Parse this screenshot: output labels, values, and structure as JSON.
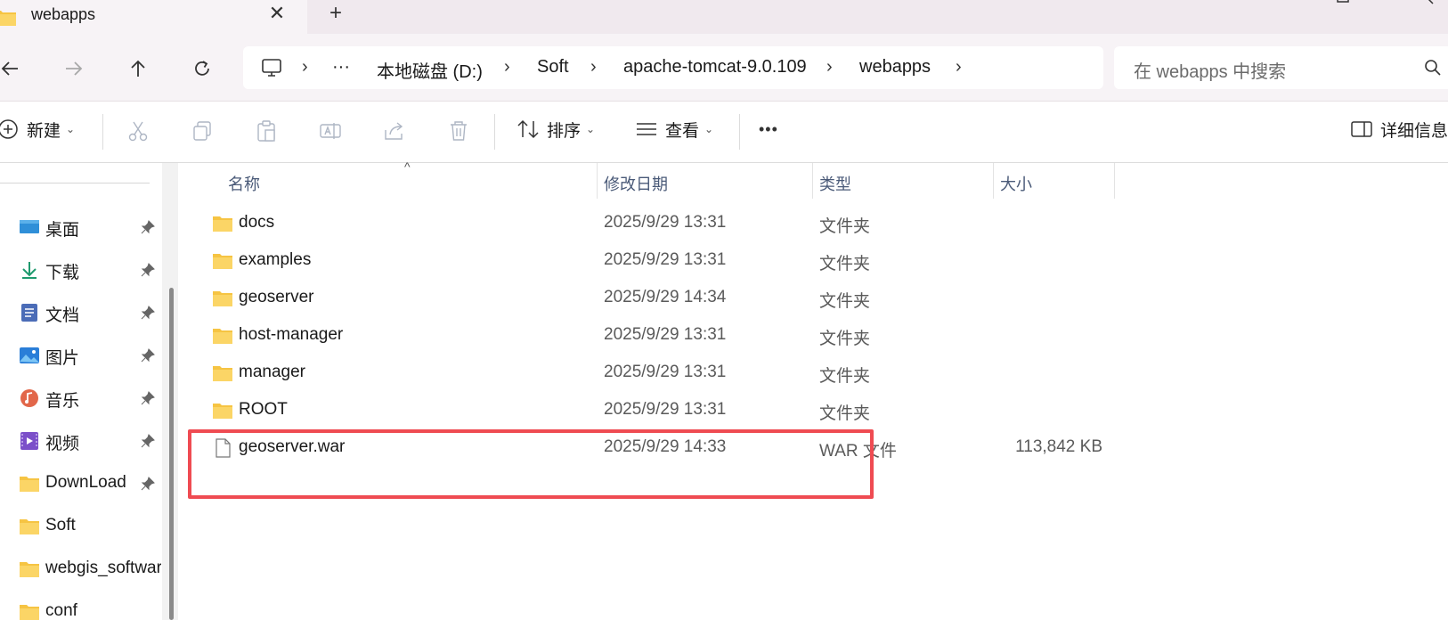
{
  "window": {
    "tab_title": "webapps",
    "close_glyph": "✕",
    "new_tab_glyph": "+"
  },
  "address": {
    "more": "···",
    "crumbs": [
      "本地磁盘 (D:)",
      "Soft",
      "apache-tomcat-9.0.109",
      "webapps"
    ],
    "sep": "›"
  },
  "search": {
    "placeholder": "在 webapps 中搜索"
  },
  "toolbar": {
    "new_label": "新建",
    "sort_label": "排序",
    "view_label": "查看",
    "more_label": "•••",
    "details_label": "详细信息",
    "chevron": "⌄"
  },
  "sidebar": {
    "items": [
      {
        "label": "桌面",
        "icon": "desktop-icon",
        "pinned": true
      },
      {
        "label": "下载",
        "icon": "download-icon",
        "pinned": true
      },
      {
        "label": "文档",
        "icon": "document-icon",
        "pinned": true
      },
      {
        "label": "图片",
        "icon": "pictures-icon",
        "pinned": true
      },
      {
        "label": "音乐",
        "icon": "music-icon",
        "pinned": true
      },
      {
        "label": "视频",
        "icon": "video-icon",
        "pinned": true
      },
      {
        "label": "DownLoad",
        "icon": "folder-icon",
        "pinned": true
      },
      {
        "label": "Soft",
        "icon": "folder-icon",
        "pinned": false
      },
      {
        "label": "webgis_software",
        "icon": "folder-icon",
        "pinned": false
      },
      {
        "label": "conf",
        "icon": "folder-icon",
        "pinned": false
      }
    ]
  },
  "columns": {
    "name": "名称",
    "date": "修改日期",
    "type": "类型",
    "size": "大小",
    "sort_glyph": "^"
  },
  "files": [
    {
      "name": "docs",
      "date": "2025/9/29 13:31",
      "type": "文件夹",
      "size": "",
      "icon": "folder-icon"
    },
    {
      "name": "examples",
      "date": "2025/9/29 13:31",
      "type": "文件夹",
      "size": "",
      "icon": "folder-icon"
    },
    {
      "name": "geoserver",
      "date": "2025/9/29 14:34",
      "type": "文件夹",
      "size": "",
      "icon": "folder-icon"
    },
    {
      "name": "host-manager",
      "date": "2025/9/29 13:31",
      "type": "文件夹",
      "size": "",
      "icon": "folder-icon"
    },
    {
      "name": "manager",
      "date": "2025/9/29 13:31",
      "type": "文件夹",
      "size": "",
      "icon": "folder-icon"
    },
    {
      "name": "ROOT",
      "date": "2025/9/29 13:31",
      "type": "文件夹",
      "size": "",
      "icon": "folder-icon"
    },
    {
      "name": "geoserver.war",
      "date": "2025/9/29 14:33",
      "type": "WAR 文件",
      "size": "113,842 KB",
      "icon": "file-icon"
    }
  ],
  "colors": {
    "highlight": "#ef4b52",
    "folder": "#f6c443",
    "accent": "#1a73c8"
  }
}
